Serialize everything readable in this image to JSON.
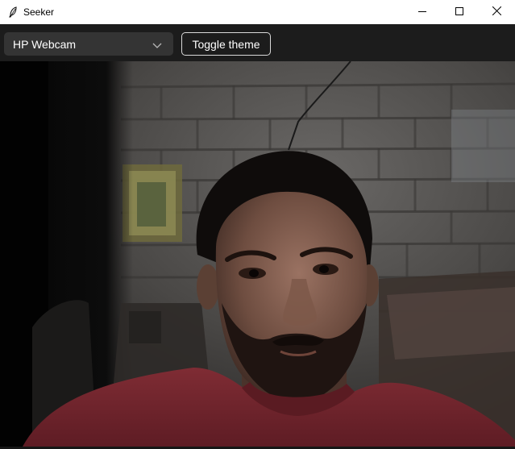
{
  "window": {
    "title": "Seeker",
    "app_icon": "feather-icon",
    "controls": [
      "minimize-icon",
      "maximize-icon",
      "close-icon"
    ]
  },
  "toolbar": {
    "camera_select": {
      "value": "HP Webcam",
      "icon": "chevron-down-icon"
    },
    "toggle_theme_label": "Toggle theme"
  },
  "colors": {
    "toolbar_bg": "#1c1c1c",
    "select_bg": "#343434",
    "shirt": "#7a2a32"
  }
}
